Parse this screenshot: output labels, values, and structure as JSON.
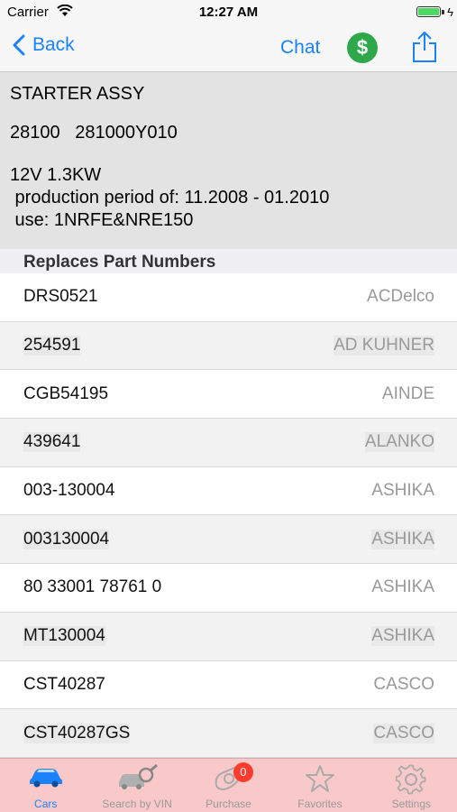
{
  "status_bar": {
    "carrier": "Carrier",
    "time": "12:27 AM",
    "battery_level": 1.0
  },
  "nav": {
    "back_label": "Back",
    "chat_label": "Chat",
    "dollar_symbol": "$"
  },
  "part": {
    "name": "STARTER ASSY",
    "numbers": "28100   281000Y010",
    "description": "12V 1.3KW\n production period of: 11.2008 - 01.2010\n use: 1NRFE&NRE150"
  },
  "replaces": {
    "header": "Replaces Part Numbers",
    "rows": [
      {
        "number": "DRS0521",
        "brand": "ACDelco"
      },
      {
        "number": "254591",
        "brand": "AD KUHNER"
      },
      {
        "number": "CGB54195",
        "brand": "AINDE"
      },
      {
        "number": "439641",
        "brand": "ALANKO"
      },
      {
        "number": "003-130004",
        "brand": "ASHIKA"
      },
      {
        "number": "003130004",
        "brand": "ASHIKA"
      },
      {
        "number": "80 33001 78761 0",
        "brand": "ASHIKA"
      },
      {
        "number": "MT130004",
        "brand": "ASHIKA"
      },
      {
        "number": "CST40287",
        "brand": "CASCO"
      },
      {
        "number": "CST40287GS",
        "brand": "CASCO"
      }
    ]
  },
  "tabs": [
    {
      "label": "Cars",
      "icon": "car-icon",
      "active": true
    },
    {
      "label": "Search by VIN",
      "icon": "vin-search-icon",
      "active": false
    },
    {
      "label": "Purchase",
      "icon": "purchase-icon",
      "active": false,
      "badge": "0"
    },
    {
      "label": "Favorites",
      "icon": "star-icon",
      "active": false
    },
    {
      "label": "Settings",
      "icon": "gear-icon",
      "active": false
    }
  ],
  "colors": {
    "accent": "#1a82fb",
    "dollar_green": "#2ea84a",
    "tab_bar_bg": "#f9c9c9",
    "badge_red": "#ff3b30"
  }
}
